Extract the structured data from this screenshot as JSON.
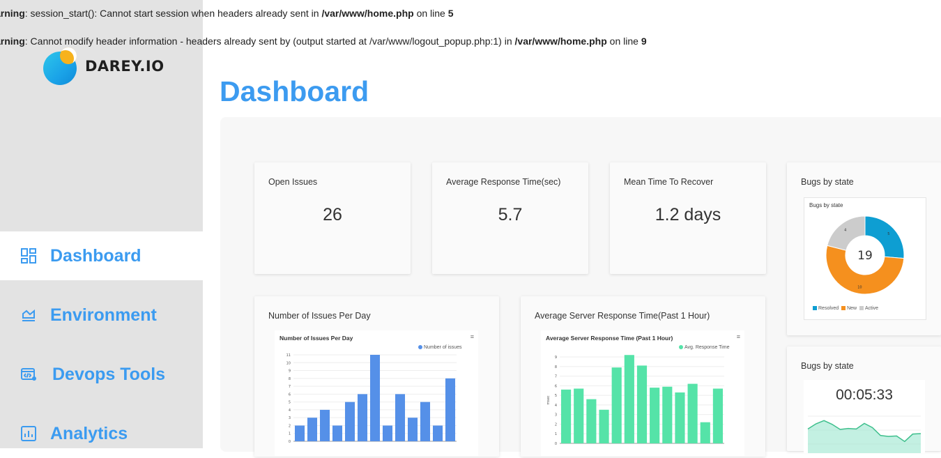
{
  "warnings": [
    {
      "prefix": "arning",
      "msg": ": session_start(): Cannot start session when headers already sent in ",
      "file": "/var/www/home.php",
      "on_line": " on line ",
      "line": "5"
    },
    {
      "prefix": "arning",
      "msg": ": Cannot modify header information - headers already sent by (output started at /var/www/logout_popup.php:1) in ",
      "file": "/var/www/home.php",
      "on_line": " on line ",
      "line": "9"
    }
  ],
  "brand": {
    "name": "DAREY.IO"
  },
  "nav": [
    {
      "label": "Dashboard",
      "icon": "dashboard-icon",
      "active": true
    },
    {
      "label": "Environment",
      "icon": "environment-icon",
      "active": false
    },
    {
      "label": "Devops Tools",
      "icon": "devops-tools-icon",
      "active": false
    },
    {
      "label": "Analytics",
      "icon": "analytics-icon",
      "active": false
    }
  ],
  "page_title": "Dashboard",
  "kpis": [
    {
      "label": "Open Issues",
      "value": "26"
    },
    {
      "label": "Average Response Time(sec)",
      "value": "5.7"
    },
    {
      "label": "Mean Time To Recover",
      "value": "1.2 days"
    }
  ],
  "bugs_card": {
    "label": "Bugs by state"
  },
  "timer_card": {
    "label": "Bugs by state",
    "value": "00:05:33"
  },
  "issues_card": {
    "label": "Number of Issues Per Day"
  },
  "response_card": {
    "label": "Average Server Response Time(Past 1 Hour)"
  },
  "colors": {
    "accent": "#3b9bf0",
    "bar_blue": "#5590e8",
    "bar_green": "#55e3a8",
    "donut_resolved": "#0e9ed2",
    "donut_new": "#f5901e",
    "donut_active": "#cccccc"
  },
  "chart_data": [
    {
      "type": "pie",
      "title": "Bugs by state",
      "center_label": "19",
      "series": [
        {
          "name": "Resolved",
          "value": 5,
          "color": "#0e9ed2"
        },
        {
          "name": "New",
          "value": 10,
          "color": "#f5901e"
        },
        {
          "name": "Active",
          "value": 4,
          "color": "#cccccc"
        }
      ]
    },
    {
      "type": "bar",
      "title": "Number of Issues Per Day",
      "series": [
        {
          "name": "Number of issues",
          "values": [
            2,
            3,
            4,
            2,
            5,
            6,
            11,
            2,
            6,
            3,
            5,
            2,
            8
          ]
        }
      ],
      "yticks": [
        "0",
        "1",
        "2",
        "3",
        "4",
        "5",
        "6",
        "7",
        "8",
        "9",
        "10",
        "11"
      ],
      "ylim": [
        0,
        11
      ]
    },
    {
      "type": "bar",
      "title": "Average Server Response Time (Past 1 Hour)",
      "series": [
        {
          "name": "Avg. Response Time",
          "values": [
            5.6,
            5.7,
            4.6,
            3.5,
            7.9,
            9.2,
            8.1,
            5.8,
            5.9,
            5.3,
            6.2,
            2.2,
            5.7
          ]
        }
      ],
      "ylabel": "msec",
      "yticks": [
        "0",
        "1",
        "2",
        "3",
        "4",
        "5",
        "6",
        "7",
        "8",
        "9"
      ],
      "ylim": [
        0,
        9
      ]
    },
    {
      "type": "area",
      "values": [
        5.2,
        6.3,
        7.0,
        6.2,
        5.1,
        5.3,
        5.2,
        6.4,
        5.5,
        3.8,
        3.6,
        3.7,
        2.5,
        4.1,
        4.2
      ]
    }
  ]
}
